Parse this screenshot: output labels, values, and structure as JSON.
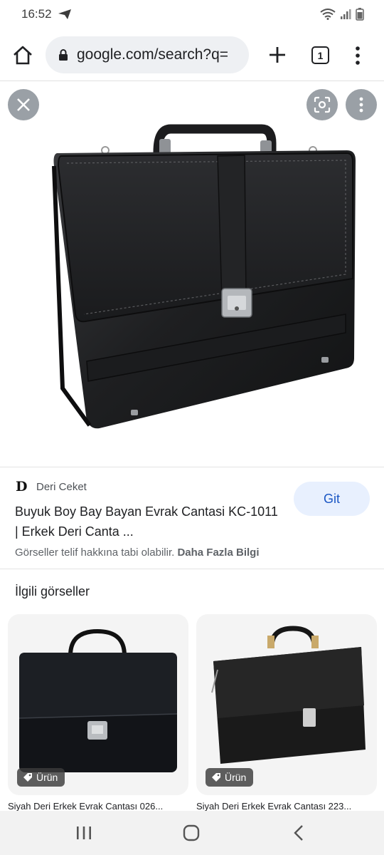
{
  "status_bar": {
    "time": "16:52",
    "icons": [
      "telegram-send-icon",
      "wifi-icon",
      "signal-icon",
      "battery-icon"
    ]
  },
  "browser": {
    "url": "google.com/search?q=",
    "tab_count": "1",
    "icons": [
      "home-icon",
      "lock-icon",
      "plus-icon",
      "more-vert-icon"
    ]
  },
  "viewer": {
    "icons": [
      "close-icon",
      "lens-icon",
      "more-vert-icon"
    ],
    "image_subject": "black leather briefcase"
  },
  "result": {
    "source_logo": "D",
    "source_name": "Deri Ceket",
    "title": "Buyuk Boy Bay Bayan Evrak Cantasi KC-1011 | Erkek Deri Canta ...",
    "go_label": "Git",
    "copyright": "Görseller telif hakkına tabi olabilir.",
    "more_info": "Daha Fazla Bilgi"
  },
  "related": {
    "heading": "İlgili görseller",
    "cards": [
      {
        "badge": "Ürün",
        "caption": "Siyah Deri Erkek Evrak Cantası 026..."
      },
      {
        "badge": "Ürün",
        "caption": "Siyah Deri Erkek Evrak Cantası 223..."
      }
    ]
  },
  "nav_bar": {
    "icons": [
      "recents-icon",
      "home-circle-icon",
      "back-icon"
    ]
  },
  "colors": {
    "accent": "#1a56c4",
    "button_bg": "#e8f0fe",
    "omnibox_bg": "#eef0f3"
  }
}
